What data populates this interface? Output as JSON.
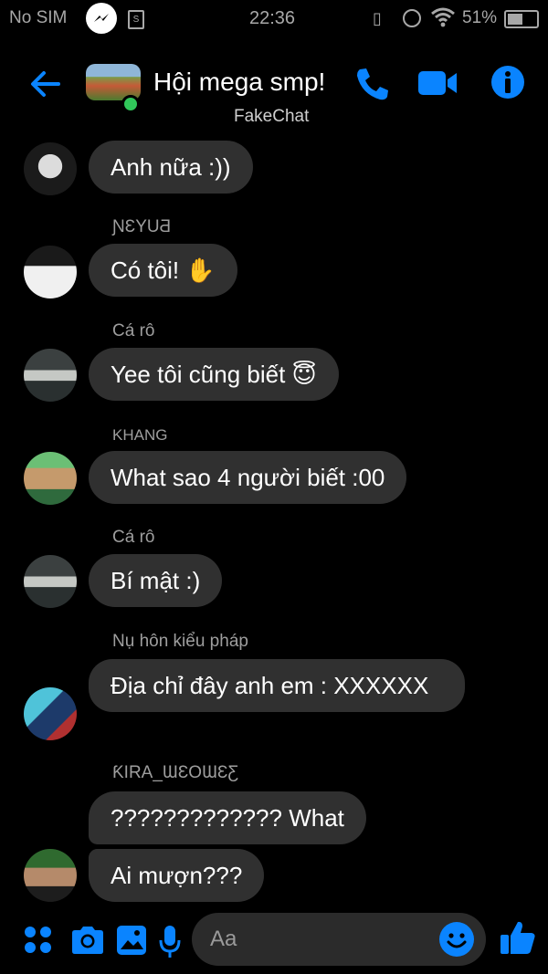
{
  "status_bar": {
    "carrier": "No SIM",
    "time": "22:36",
    "battery": "51%"
  },
  "header": {
    "title": "Hội mega smp!",
    "subtitle": "FakeChat"
  },
  "messages": [
    {
      "sender": "",
      "text": "Anh nữa :))"
    },
    {
      "sender": "ƝƐYUƋ",
      "text": "Có tôi! ✋"
    },
    {
      "sender": "Cá rô",
      "text": "Yee tôi cũng biết 😇"
    },
    {
      "sender": "KHANG",
      "text": "What sao 4 người biết :00"
    },
    {
      "sender": "Cá rô",
      "text": "Bí mật :)"
    },
    {
      "sender": "Nụ hôn kiểu pháp",
      "text": "Địa chỉ đây anh em : XXXXXX"
    },
    {
      "sender": "ƘIRA_ƜƐOƜƐƸ",
      "text": "????????????? What"
    },
    {
      "sender": "",
      "text": "Ai mượn???"
    }
  ],
  "composer": {
    "placeholder": "Aa"
  },
  "colors": {
    "accent": "#0a84ff",
    "bubble": "#303030",
    "background": "#000000",
    "online": "#31c75a"
  },
  "icons": [
    "back-arrow-icon",
    "phone-icon",
    "video-camera-icon",
    "info-icon",
    "apps-grid-icon",
    "camera-icon",
    "image-icon",
    "microphone-icon",
    "emoji-icon",
    "thumbs-up-icon"
  ]
}
